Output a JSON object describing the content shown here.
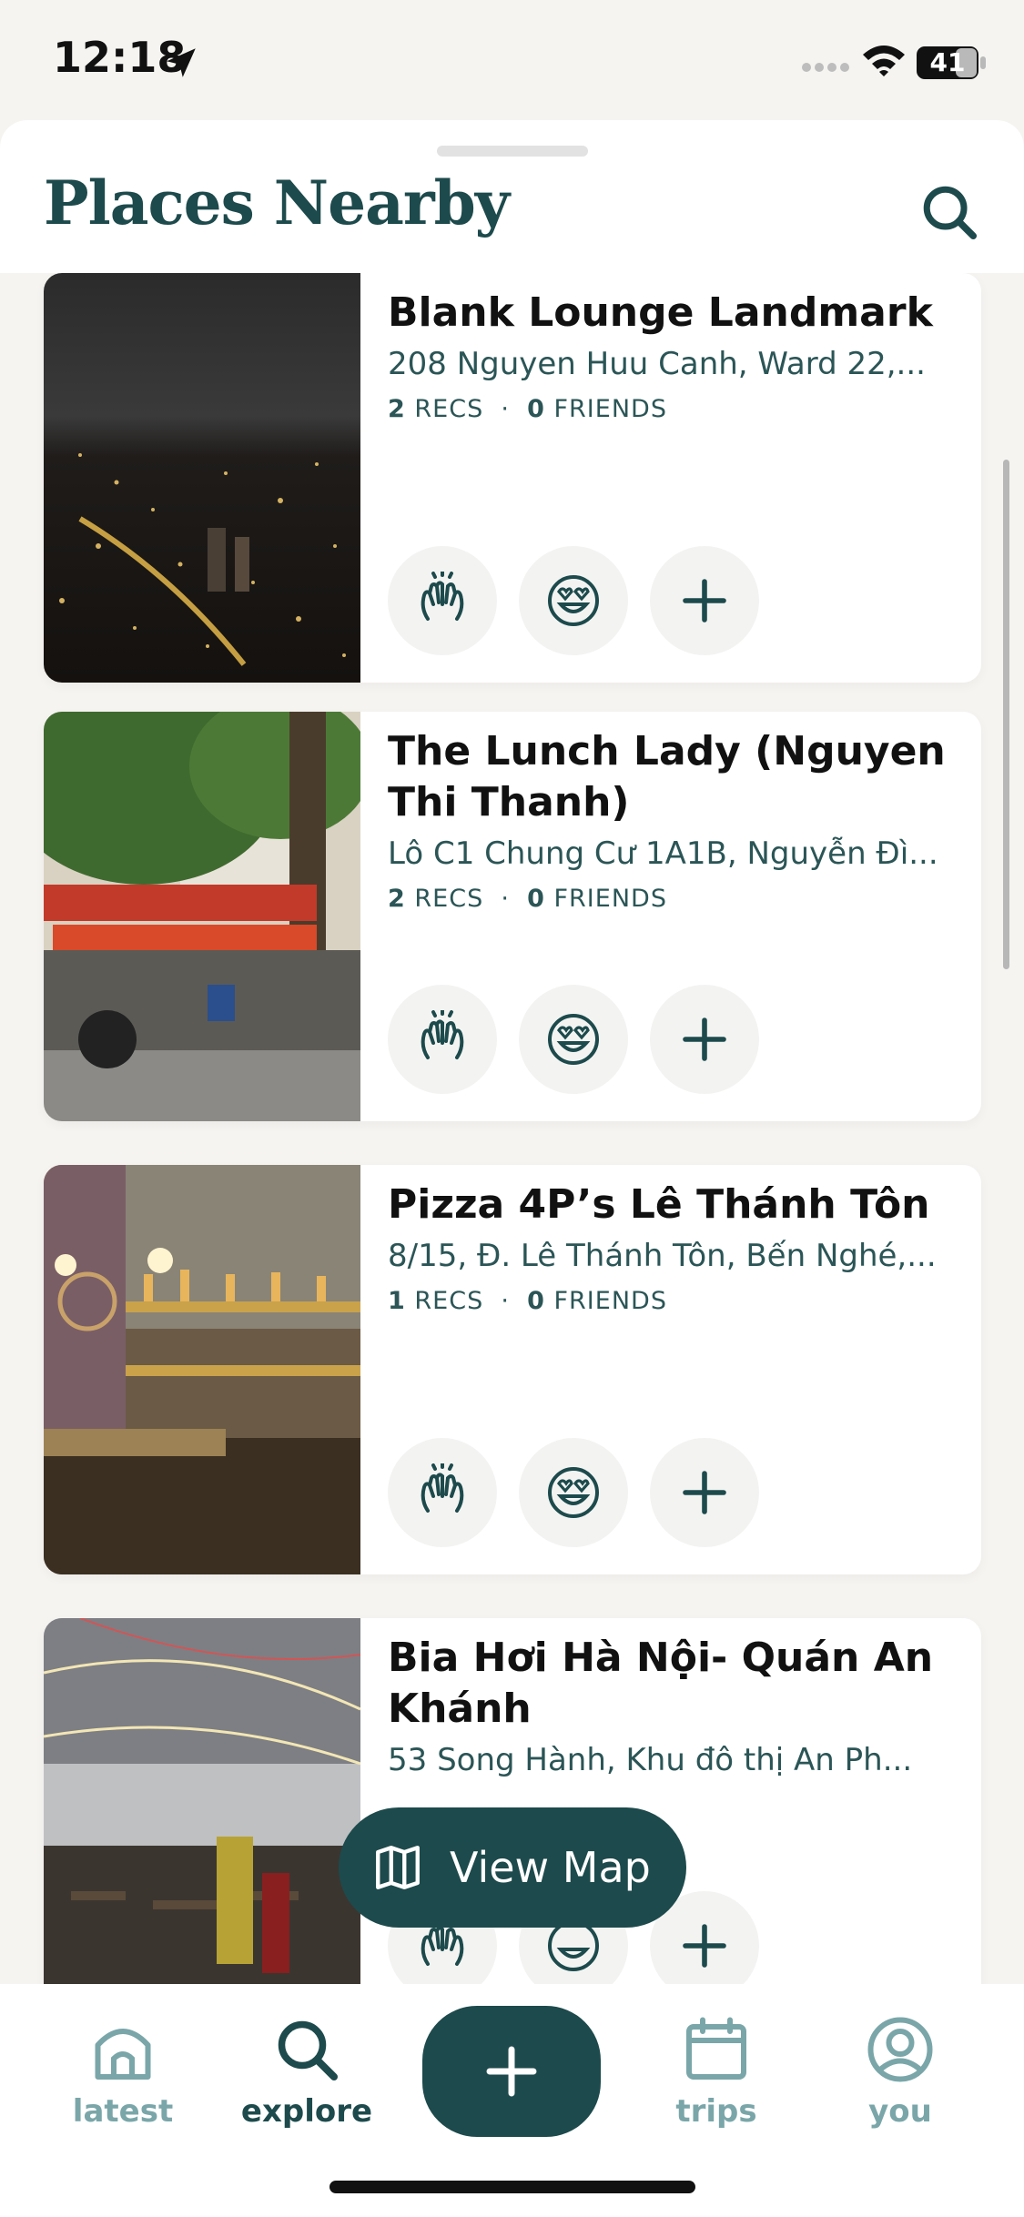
{
  "status_bar": {
    "time": "12:18",
    "battery": "41"
  },
  "header": {
    "title": "Places Nearby"
  },
  "places": [
    {
      "title": "Blank Lounge Landmark",
      "address": "208 Nguyen Huu Canh, Ward 22,...",
      "recs_count": "2",
      "recs_label": "RECS",
      "friends_count": "0",
      "friends_label": "FRIENDS"
    },
    {
      "title": "The Lunch Lady (Nguyen Thi Thanh)",
      "address": "Lô C1 Chung Cư 1A1B, Nguyễn Đì...",
      "recs_count": "2",
      "recs_label": "RECS",
      "friends_count": "0",
      "friends_label": "FRIENDS"
    },
    {
      "title": "Pizza 4P’s Lê Thánh Tôn",
      "address": "8/15, Đ. Lê Thánh Tôn, Bến Nghé,...",
      "recs_count": "1",
      "recs_label": "RECS",
      "friends_count": "0",
      "friends_label": "FRIENDS"
    },
    {
      "title": "Bia Hơi Hà Nội- Quán An Khánh",
      "address": "53 Song Hành, Khu đô thị An Ph...",
      "recs_count": "",
      "recs_label": "",
      "friends_count": "",
      "friends_label": ""
    }
  ],
  "view_map": {
    "label": "View Map"
  },
  "tabbar": {
    "latest": "latest",
    "explore": "explore",
    "trips": "trips",
    "you": "you"
  },
  "colors": {
    "brand": "#1d4a4c",
    "inactive_tab": "#7aa6a9"
  },
  "icons": [
    "location-arrow-icon",
    "wifi-icon",
    "battery-icon",
    "search-icon",
    "clap-hands-icon",
    "heart-eyes-icon",
    "plus-icon",
    "map-icon",
    "home-icon",
    "calendar-icon",
    "user-icon"
  ]
}
